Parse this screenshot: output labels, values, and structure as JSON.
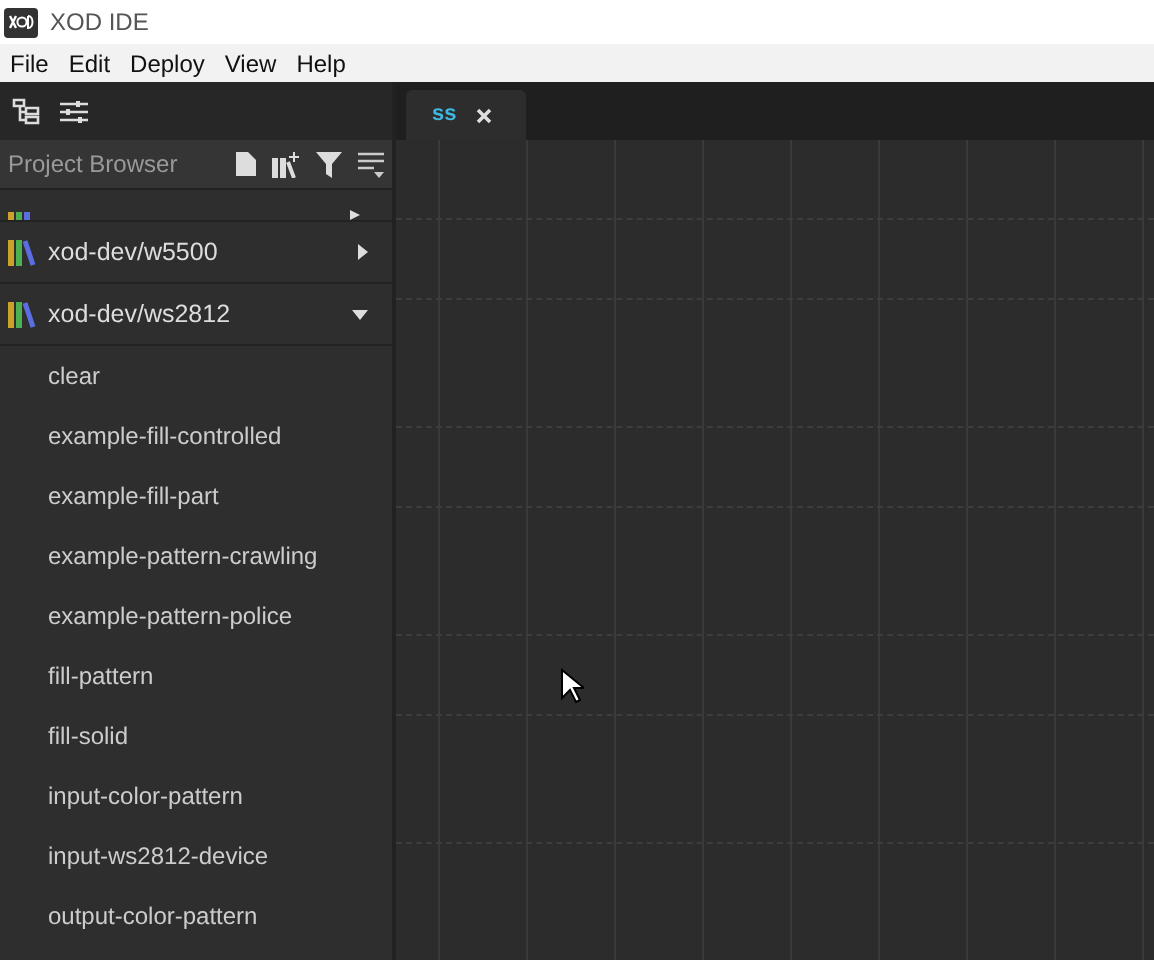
{
  "window": {
    "title": "XOD IDE"
  },
  "menu": [
    "File",
    "Edit",
    "Deploy",
    "View",
    "Help"
  ],
  "project_browser": {
    "title": "Project Browser",
    "libraries": [
      {
        "name": "xod-dev/w5500",
        "expanded": false
      },
      {
        "name": "xod-dev/ws2812",
        "expanded": true,
        "patches": [
          "clear",
          "example-fill-controlled",
          "example-fill-part",
          "example-pattern-crawling",
          "example-pattern-police",
          "fill-pattern",
          "fill-solid",
          "input-color-pattern",
          "input-ws2812-device",
          "output-color-pattern"
        ]
      }
    ]
  },
  "tabs": [
    {
      "label": "ss",
      "selected": true
    }
  ]
}
